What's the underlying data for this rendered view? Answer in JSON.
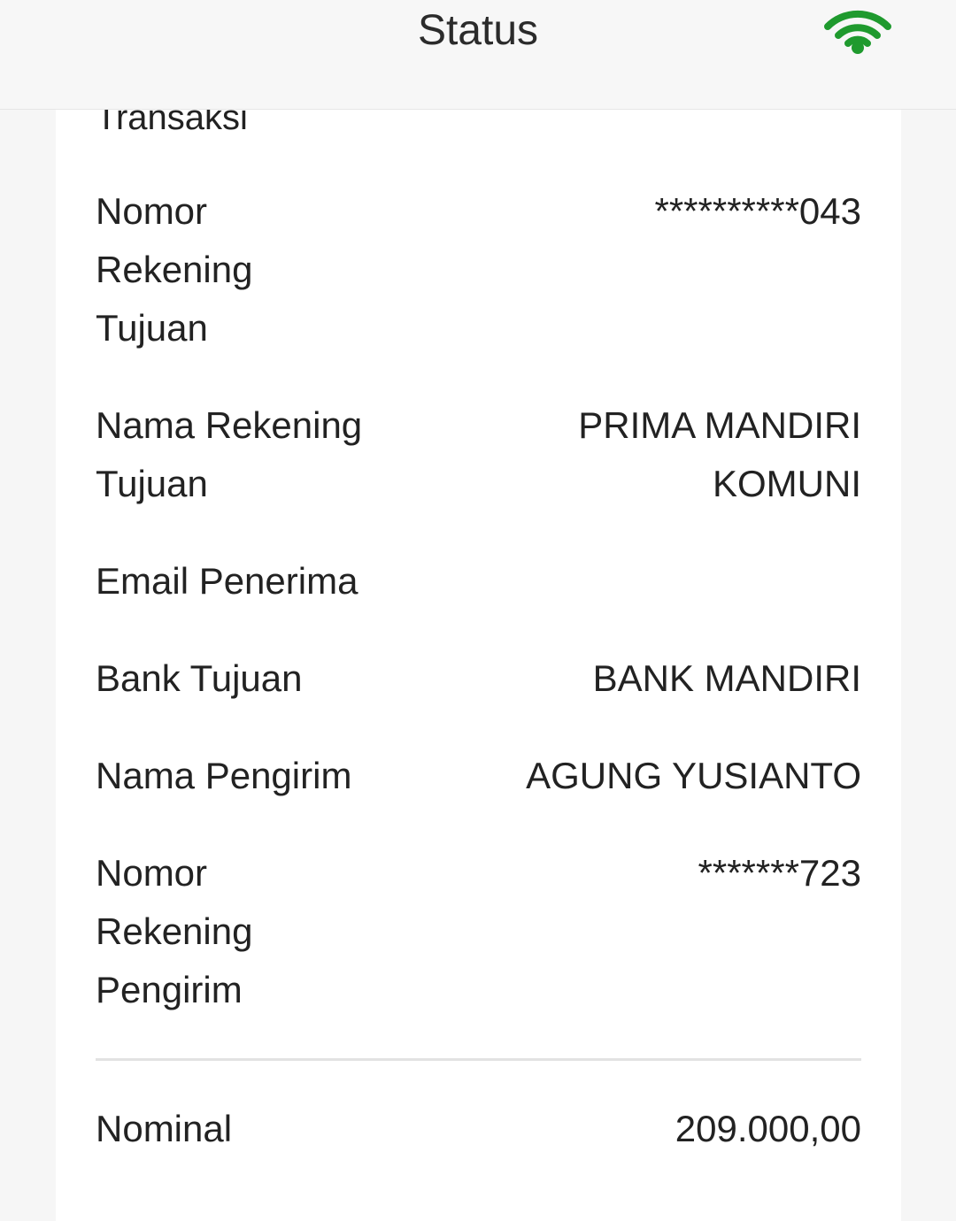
{
  "header": {
    "title": "Status",
    "wifi_icon": "wifi-icon",
    "wifi_color": "#1f9a2e"
  },
  "card": {
    "clipped_label": "Transaksi",
    "rows": [
      {
        "label_lines": [
          "Nomor",
          "Rekening",
          "Tujuan"
        ],
        "value_lines": [
          "**********043"
        ]
      },
      {
        "label_lines": [
          "Nama Rekening",
          "Tujuan"
        ],
        "value_lines": [
          "PRIMA MANDIRI",
          "KOMUNI"
        ]
      },
      {
        "label_lines": [
          "Email Penerima"
        ],
        "value_lines": [
          ""
        ]
      },
      {
        "label_lines": [
          "Bank Tujuan"
        ],
        "value_lines": [
          "BANK MANDIRI"
        ]
      },
      {
        "label_lines": [
          "Nama Pengirim"
        ],
        "value_lines": [
          "AGUNG YUSIANTO"
        ]
      },
      {
        "label_lines": [
          "Nomor",
          "Rekening",
          "Pengirim"
        ],
        "value_lines": [
          "*******723"
        ]
      }
    ],
    "nominal": {
      "label": "Nominal",
      "value": "209.000,00"
    }
  }
}
